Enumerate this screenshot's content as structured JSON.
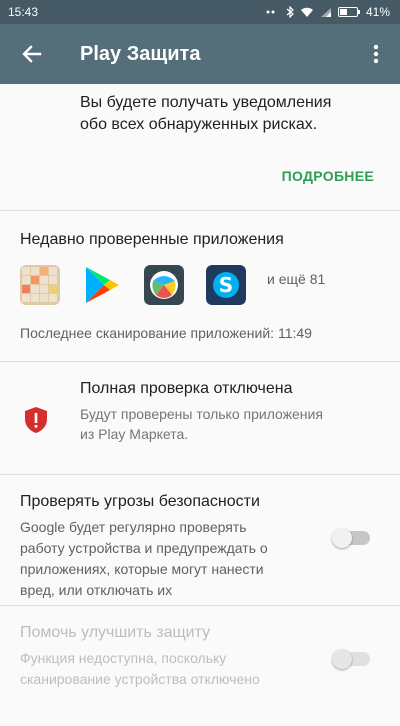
{
  "status_bar": {
    "time": "15:43",
    "battery_percent": "41%"
  },
  "app_bar": {
    "title": "Play Защита"
  },
  "notification_section": {
    "line1": "Вы будете получать уведомления",
    "line2": "обо всех обнаруженных рисках.",
    "more_label": "ПОДРОБНЕЕ"
  },
  "recent_apps": {
    "title": "Недавно проверенные приложения",
    "apps": [
      "2048-icon",
      "google-play-icon",
      "globe-app-icon",
      "skype-icon"
    ],
    "more_count": "и ещё 81",
    "last_scan": "Последнее сканирование приложений: 11:49"
  },
  "full_check": {
    "title": "Полная проверка отключена",
    "desc_line1": "Будут проверены только приложения",
    "desc_line2": "из Play Маркета."
  },
  "threat_check": {
    "title": "Проверять угрозы безопасности",
    "desc_line1": "Google будет регулярно проверять",
    "desc_line2": "работу устройства и предупреждать о",
    "desc_line3": "приложениях, которые могут нанести",
    "desc_line4": "вред, или отключать их",
    "enabled": false
  },
  "improve_protection": {
    "title": "Помочь улучшить защиту",
    "desc_line1": "Функция недоступна, поскольку",
    "desc_line2": "сканирование устройства отключено",
    "enabled": false,
    "available": false
  },
  "colors": {
    "status_bar": "#455a64",
    "app_bar": "#546e7a",
    "accent_green": "#2e9e53",
    "warning_red": "#d32f2f"
  }
}
